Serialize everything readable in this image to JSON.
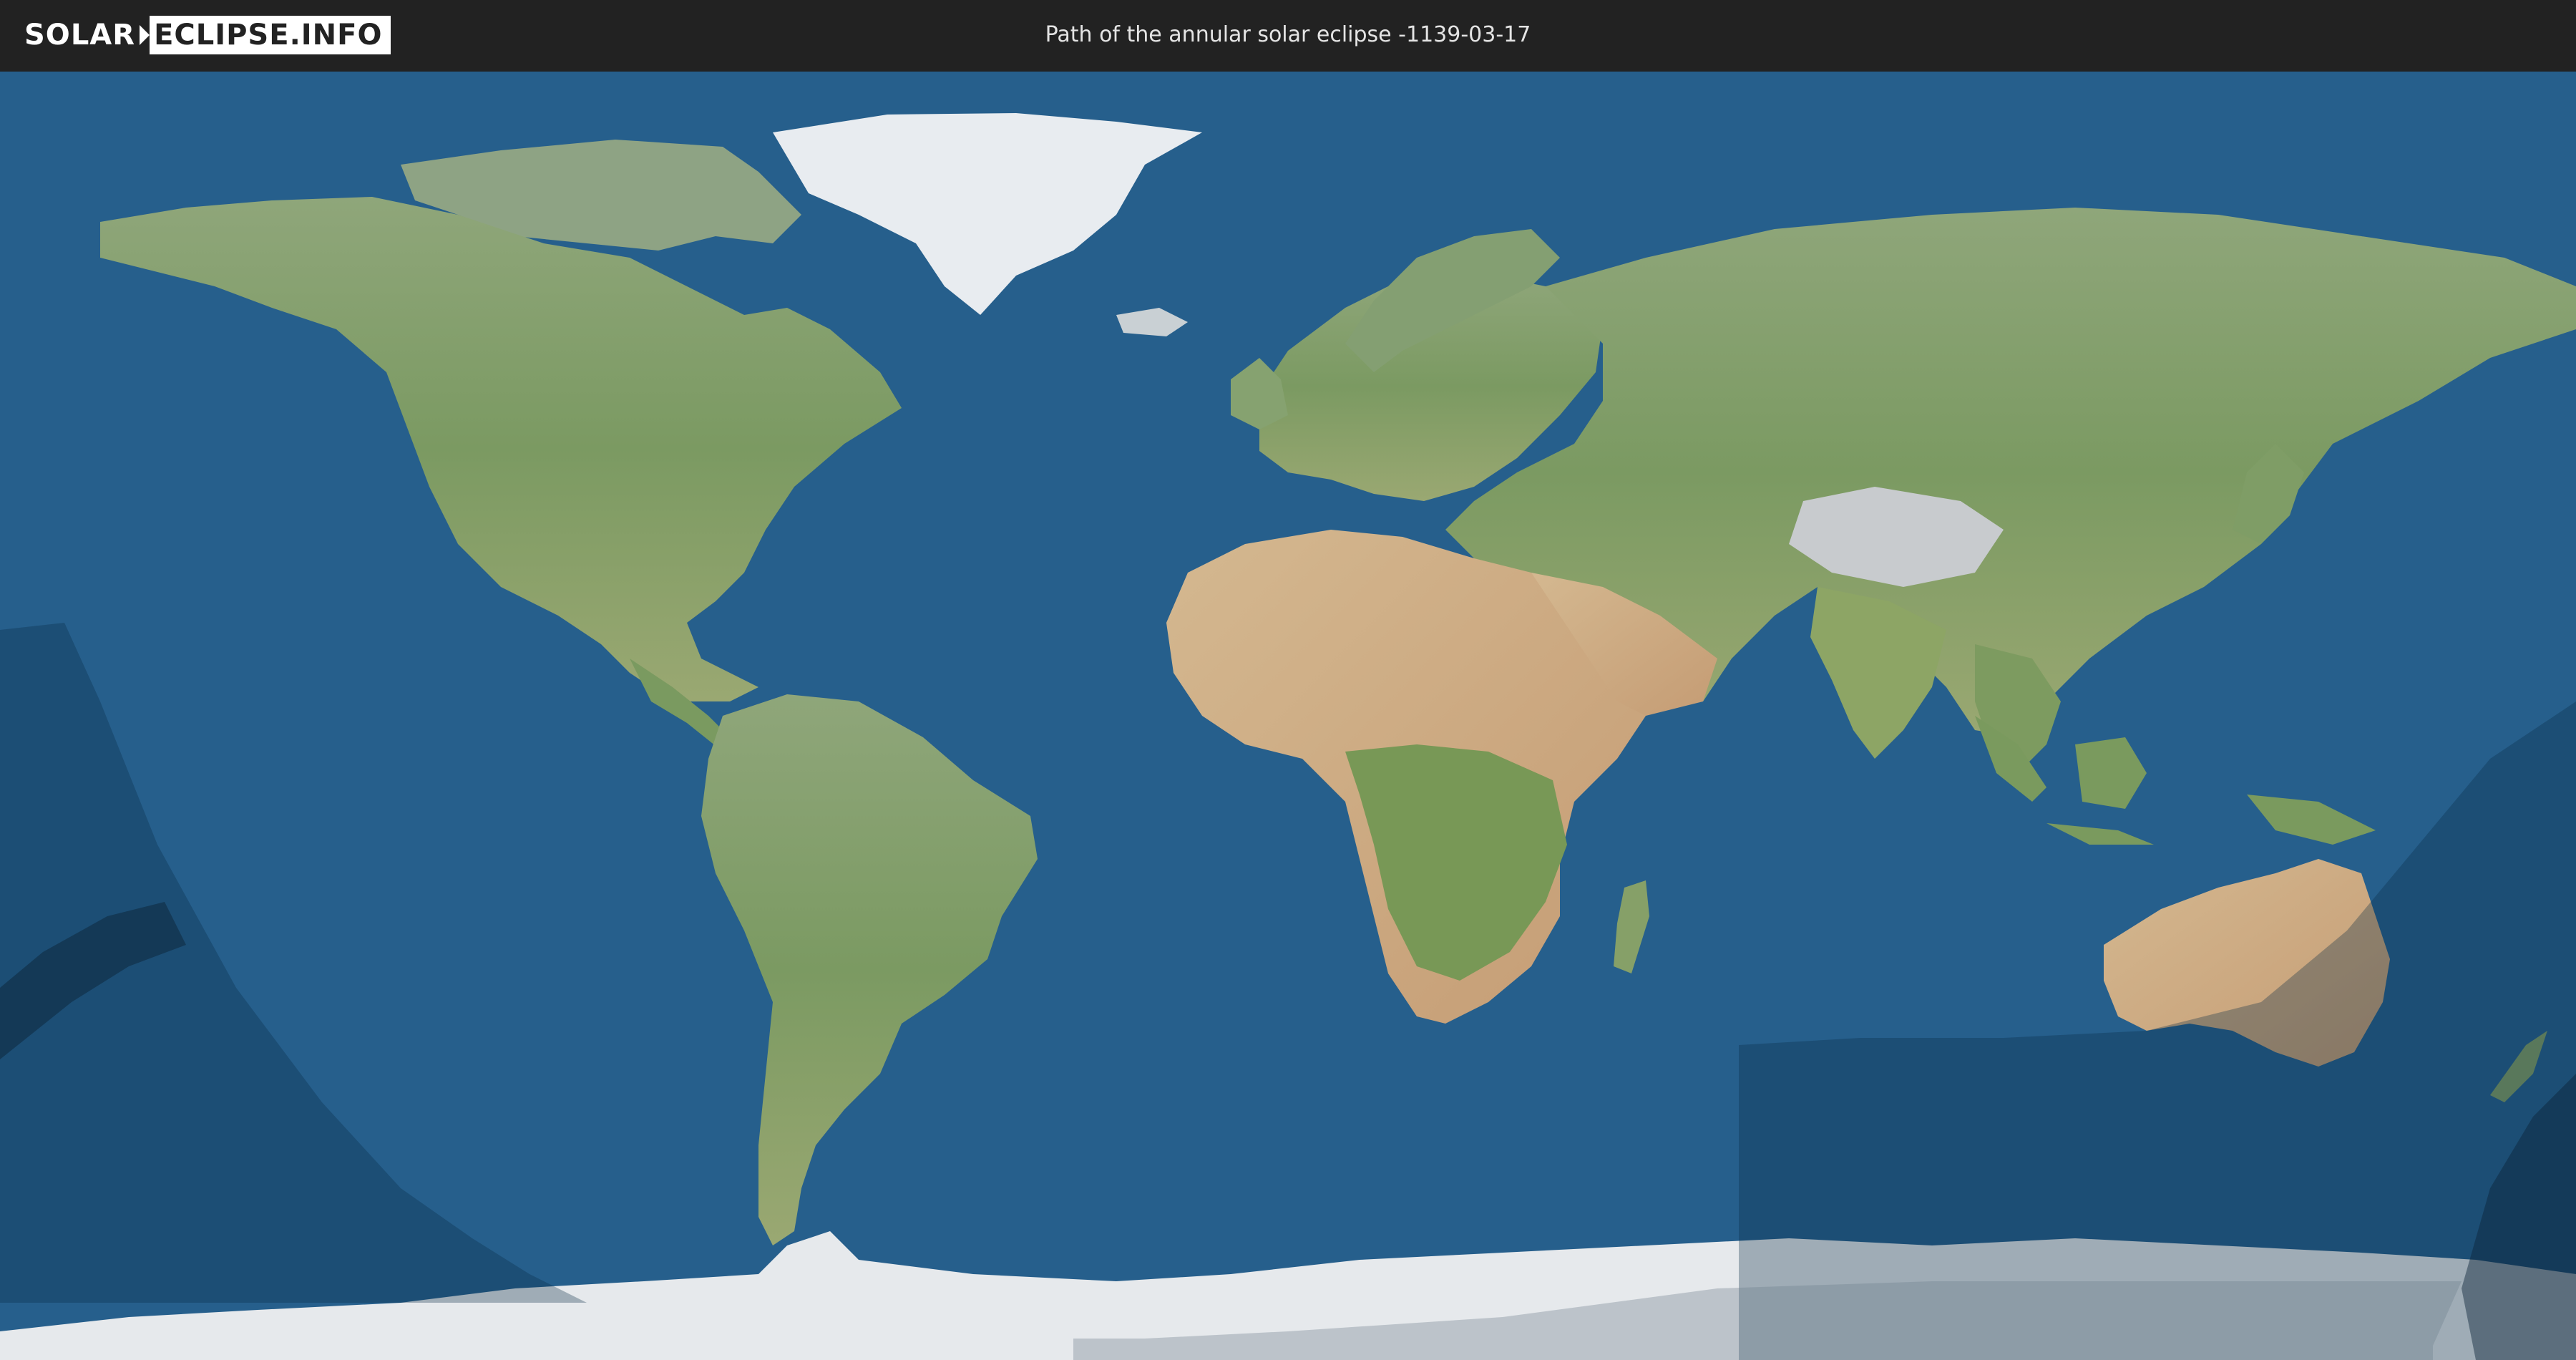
{
  "header": {
    "logo_left": "SOLAR",
    "logo_right": "ECLIPSE.INFO",
    "title": "Path of the annular solar eclipse -1139-03-17"
  },
  "map": {
    "projection": "equirectangular",
    "colors": {
      "header_bg": "#222222",
      "ocean": "#265f8c",
      "land": "#7f9d6a",
      "ice": "#e4e7eb",
      "penumbra_shade": "#0a2a44",
      "annular_path": "#0b2338"
    }
  }
}
